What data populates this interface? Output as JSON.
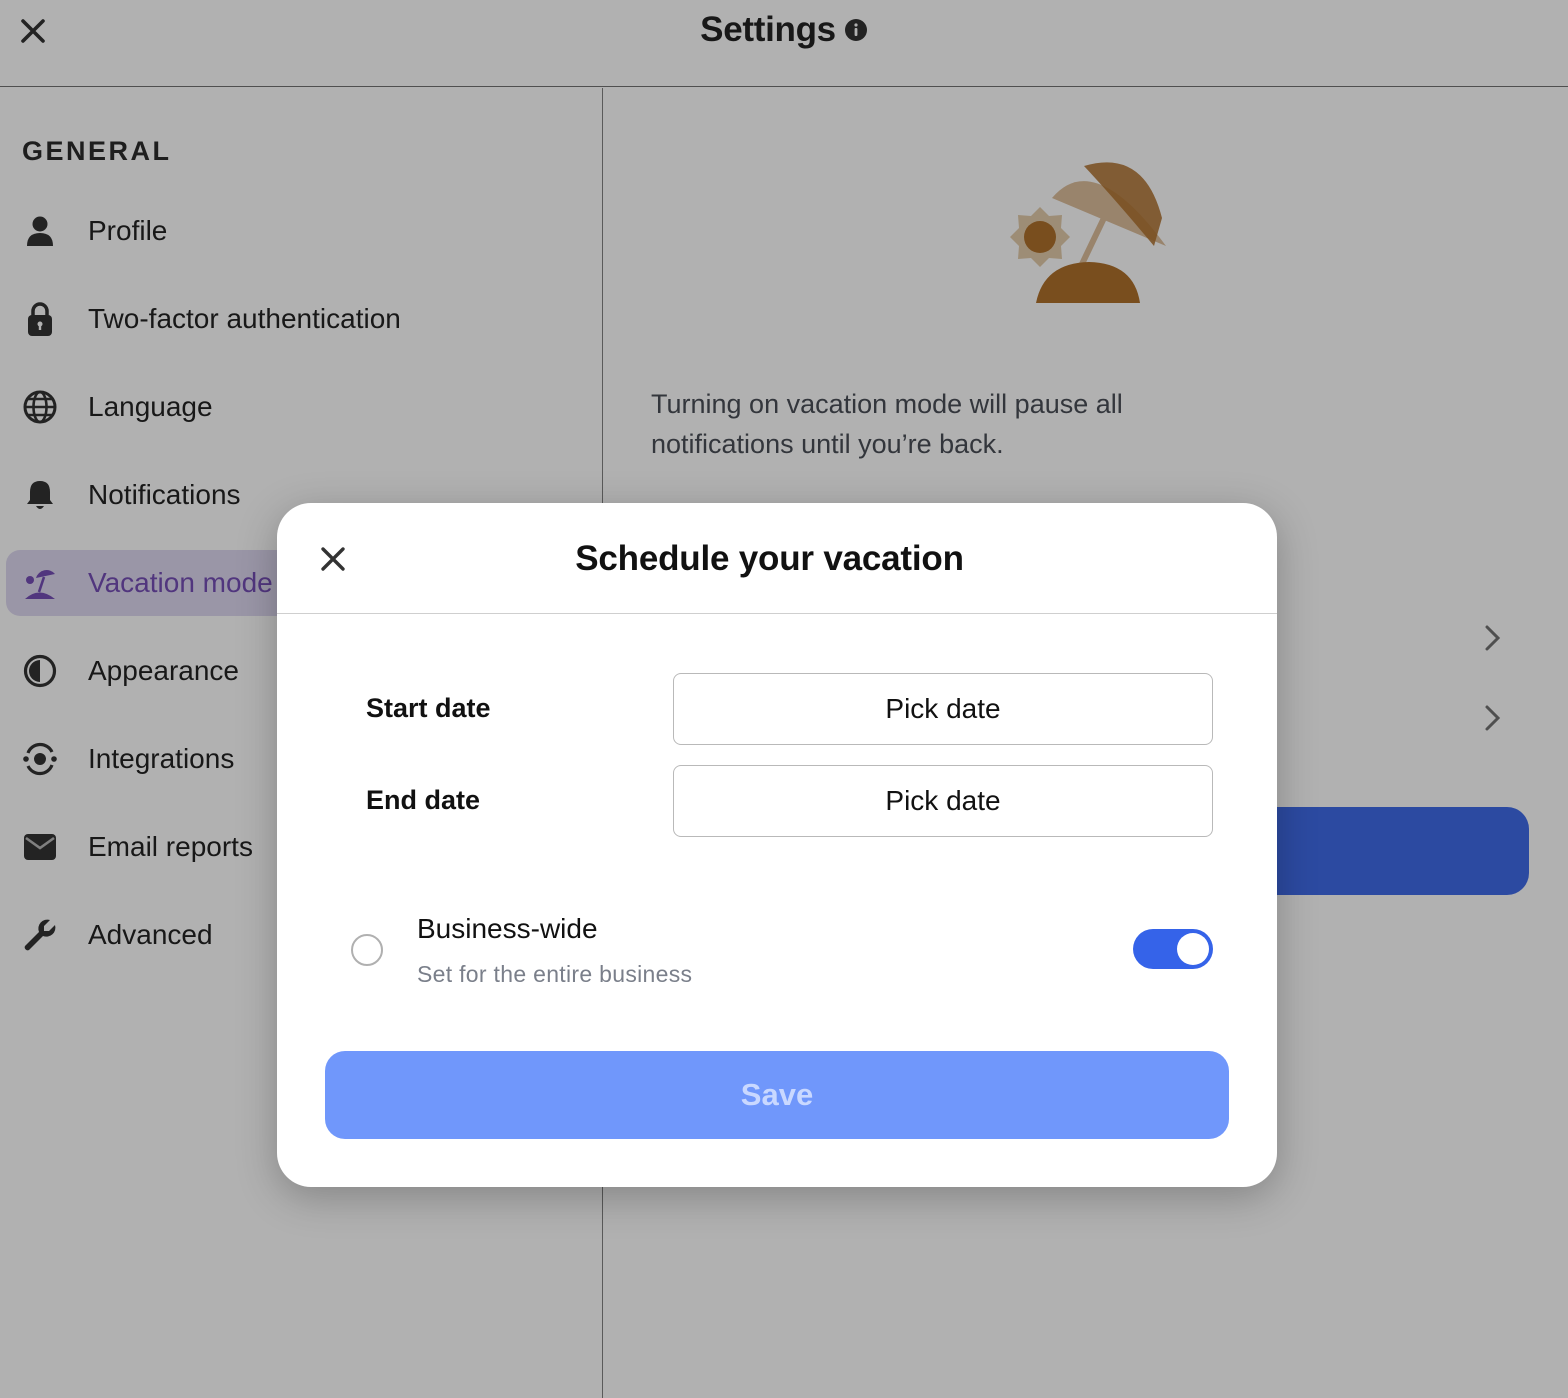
{
  "header": {
    "title": "Settings",
    "close_icon": "close-icon",
    "info_icon": "info-icon"
  },
  "sidebar": {
    "section_label": "GENERAL",
    "items": [
      {
        "label": "Profile",
        "icon": "person-icon"
      },
      {
        "label": "Two-factor authentication",
        "icon": "lock-icon"
      },
      {
        "label": "Language",
        "icon": "globe-icon"
      },
      {
        "label": "Notifications",
        "icon": "bell-icon"
      },
      {
        "label": "Vacation mode",
        "icon": "beach-umbrella-icon",
        "active": true
      },
      {
        "label": "Appearance",
        "icon": "contrast-icon"
      },
      {
        "label": "Integrations",
        "icon": "integrations-icon"
      },
      {
        "label": "Email reports",
        "icon": "envelope-icon"
      },
      {
        "label": "Advanced",
        "icon": "wrench-icon"
      }
    ]
  },
  "content": {
    "description": "Turning on vacation mode will pause all notifications until you’re back.",
    "illustration_icon": "beach-umbrella-illustration"
  },
  "modal": {
    "title": "Schedule your vacation",
    "start_date": {
      "label": "Start date",
      "button_label": "Pick date"
    },
    "end_date": {
      "label": "End date",
      "button_label": "Pick date"
    },
    "business_wide": {
      "title": "Business-wide",
      "subtitle": "Set for the entire business",
      "radio_selected": false,
      "toggle_on": true
    },
    "save_label": "Save"
  },
  "colors": {
    "accent_blue": "#3563e9",
    "save_disabled": "#7097fb",
    "active_nav_text": "#6a3fb0",
    "illustration_orange": "#a8641a"
  }
}
